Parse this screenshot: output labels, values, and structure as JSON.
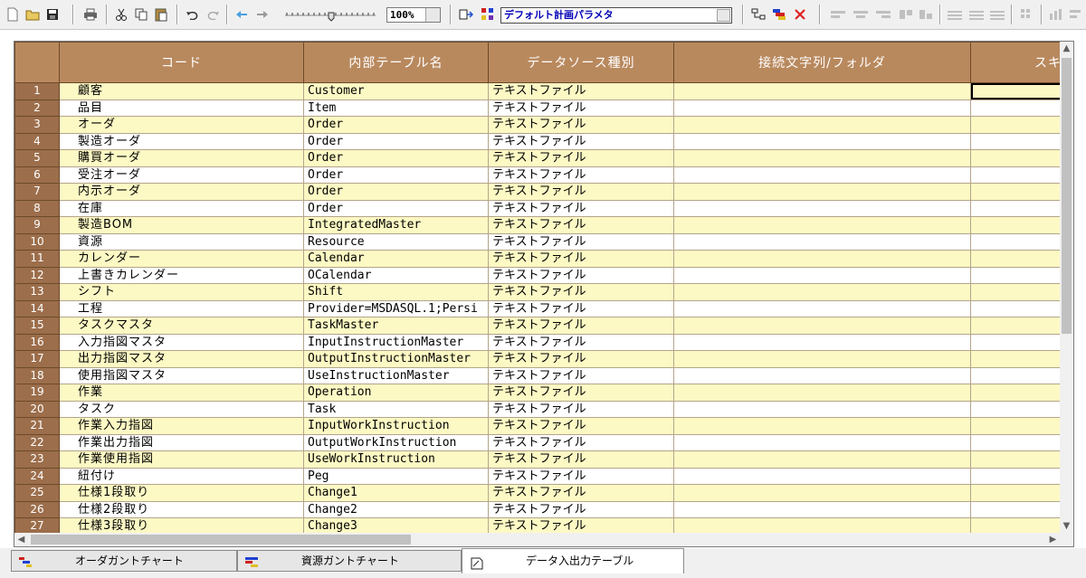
{
  "toolbar": {
    "zoom_value": "100%",
    "parameter_select": "デフォルト計画パラメタ"
  },
  "grid": {
    "columns": [
      "コード",
      "内部テーブル名",
      "データソース種別",
      "接続文字列/フォルダ",
      "スキ"
    ],
    "rows": [
      {
        "num": "1",
        "code": "顧客",
        "table": "Customer",
        "source": "テキストファイル"
      },
      {
        "num": "2",
        "code": "品目",
        "table": "Item",
        "source": "テキストファイル"
      },
      {
        "num": "3",
        "code": "オーダ",
        "table": "Order",
        "source": "テキストファイル"
      },
      {
        "num": "4",
        "code": "製造オーダ",
        "table": "Order",
        "source": "テキストファイル"
      },
      {
        "num": "5",
        "code": "購買オーダ",
        "table": "Order",
        "source": "テキストファイル"
      },
      {
        "num": "6",
        "code": "受注オーダ",
        "table": "Order",
        "source": "テキストファイル"
      },
      {
        "num": "7",
        "code": "内示オーダ",
        "table": "Order",
        "source": "テキストファイル"
      },
      {
        "num": "8",
        "code": "在庫",
        "table": "Order",
        "source": "テキストファイル"
      },
      {
        "num": "9",
        "code": "製造BOM",
        "table": "IntegratedMaster",
        "source": "テキストファイル"
      },
      {
        "num": "10",
        "code": "資源",
        "table": "Resource",
        "source": "テキストファイル"
      },
      {
        "num": "11",
        "code": "カレンダー",
        "table": "Calendar",
        "source": "テキストファイル"
      },
      {
        "num": "12",
        "code": "上書きカレンダー",
        "table": "OCalendar",
        "source": "テキストファイル"
      },
      {
        "num": "13",
        "code": "シフト",
        "table": "Shift",
        "source": "テキストファイル"
      },
      {
        "num": "14",
        "code": "工程",
        "table": "Provider=MSDASQL.1;Persi",
        "source": "テキストファイル"
      },
      {
        "num": "15",
        "code": "タスクマスタ",
        "table": "TaskMaster",
        "source": "テキストファイル"
      },
      {
        "num": "16",
        "code": "入力指図マスタ",
        "table": "InputInstructionMaster",
        "source": "テキストファイル"
      },
      {
        "num": "17",
        "code": "出力指図マスタ",
        "table": "OutputInstructionMaster",
        "source": "テキストファイル"
      },
      {
        "num": "18",
        "code": "使用指図マスタ",
        "table": "UseInstructionMaster",
        "source": "テキストファイル"
      },
      {
        "num": "19",
        "code": "作業",
        "table": "Operation",
        "source": "テキストファイル"
      },
      {
        "num": "20",
        "code": "タスク",
        "table": "Task",
        "source": "テキストファイル"
      },
      {
        "num": "21",
        "code": "作業入力指図",
        "table": "InputWorkInstruction",
        "source": "テキストファイル"
      },
      {
        "num": "22",
        "code": "作業出力指図",
        "table": "OutputWorkInstruction",
        "source": "テキストファイル"
      },
      {
        "num": "23",
        "code": "作業使用指図",
        "table": "UseWorkInstruction",
        "source": "テキストファイル"
      },
      {
        "num": "24",
        "code": "紐付け",
        "table": "Peg",
        "source": "テキストファイル"
      },
      {
        "num": "25",
        "code": "仕様1段取り",
        "table": "Change1",
        "source": "テキストファイル"
      },
      {
        "num": "26",
        "code": "仕様2段取り",
        "table": "Change2",
        "source": "テキストファイル"
      },
      {
        "num": "27",
        "code": "仕様3段取り",
        "table": "Change3",
        "source": "テキストファイル"
      }
    ]
  },
  "tabs": [
    {
      "label": "オーダガントチャート"
    },
    {
      "label": "資源ガントチャート"
    },
    {
      "label": "データ入出力テーブル"
    }
  ],
  "colors": {
    "header_bg": "#b9895e",
    "row_num_bg": "#9c6e4b",
    "odd_row_bg": "#fdf9c4",
    "param_text": "#0000b4"
  }
}
